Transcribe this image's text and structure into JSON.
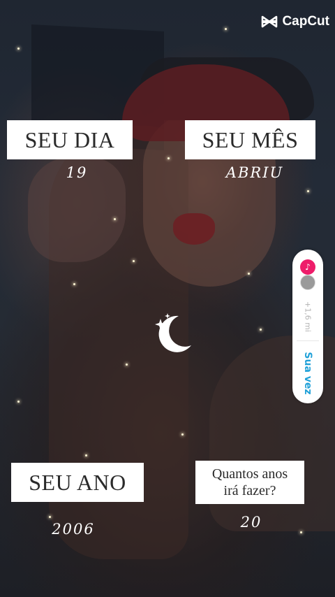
{
  "brand": {
    "name": "CapCut"
  },
  "labels": {
    "day": "SEU DIA",
    "month": "SEU MÊS",
    "year": "SEU ANO",
    "age_line1": "Quantos anos",
    "age_line2": "irá fazer?"
  },
  "values": {
    "day": "19",
    "month": "ABRIU",
    "year": "2006",
    "age": "20"
  },
  "tiktok_pill": {
    "count": "+1,6 mi",
    "cta": "Sua vez",
    "icon": "tiktok-logo-icon"
  },
  "decor": {
    "icon": "crescent-moon-sparkle-icon"
  },
  "colors": {
    "label_bg": "#ffffff",
    "label_text": "#2a2a2a",
    "value_text": "#ffffff",
    "cta_blue": "#21a1d8",
    "tiktok_pink": "#ee1d6a"
  }
}
